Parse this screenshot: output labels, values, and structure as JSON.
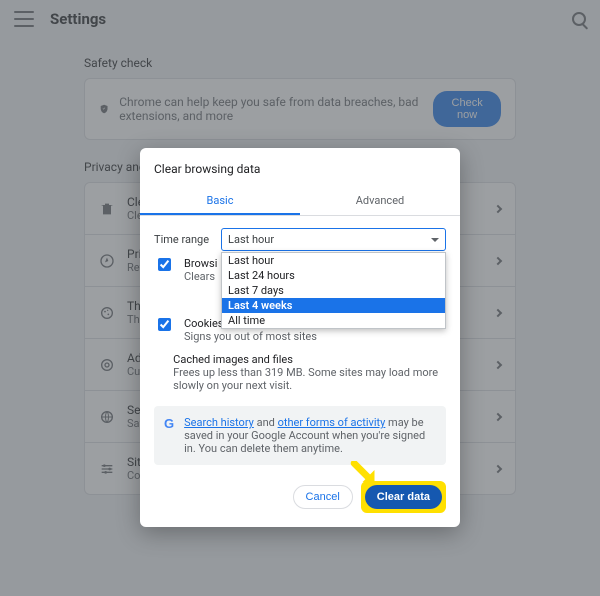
{
  "app": {
    "title": "Settings"
  },
  "safety": {
    "heading": "Safety check",
    "message": "Chrome can help keep you safe from data breaches, bad extensions, and more",
    "button": "Check now"
  },
  "privacy": {
    "heading": "Privacy and security",
    "rows": [
      {
        "title": "Clear",
        "sub": "Clear"
      },
      {
        "title": "Priva",
        "sub": "Revi"
      },
      {
        "title": "Third",
        "sub": "Thir"
      },
      {
        "title": "Ad p",
        "sub": "Cust"
      },
      {
        "title": "Secu",
        "sub": "Safe"
      },
      {
        "title": "Site",
        "sub": "Cont"
      }
    ]
  },
  "dialog": {
    "title": "Clear browsing data",
    "tabs": {
      "basic": "Basic",
      "advanced": "Advanced"
    },
    "time_range_label": "Time range",
    "time_range_value": "Last hour",
    "time_range_options": [
      "Last hour",
      "Last 24 hours",
      "Last 7 days",
      "Last 4 weeks",
      "All time"
    ],
    "time_range_highlighted": "Last 4 weeks",
    "items": [
      {
        "title": "Browsi",
        "sub": "Clears"
      },
      {
        "title": "Cookies and other site data",
        "sub": "Signs you out of most sites"
      },
      {
        "title": "Cached images and files",
        "sub": "Frees up less than 319 MB. Some sites may load more slowly on your next visit."
      }
    ],
    "info_prefix": "",
    "info_link1": "Search history",
    "info_mid": " and ",
    "info_link2": "other forms of activity",
    "info_suffix": " may be saved in your Google Account when you're signed in. You can delete them anytime.",
    "cancel": "Cancel",
    "clear": "Clear data"
  }
}
